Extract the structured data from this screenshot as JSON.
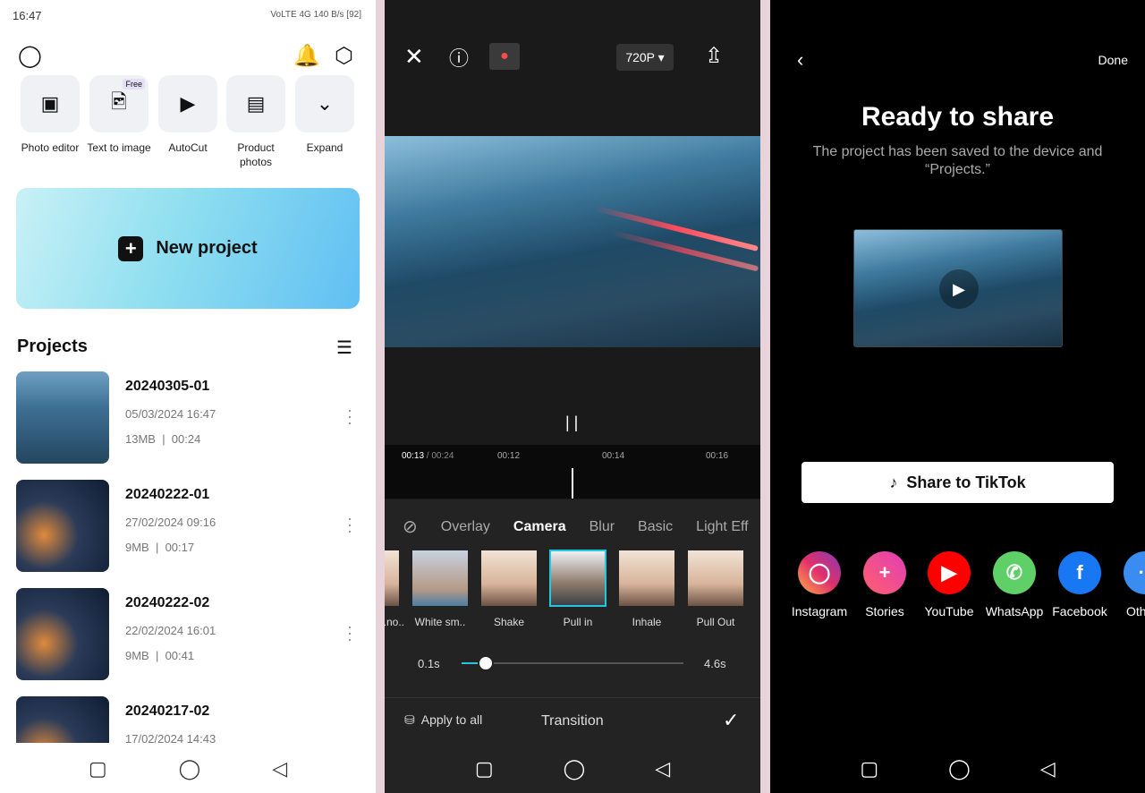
{
  "home": {
    "status": {
      "time": "16:47",
      "network": "VoLTE 4G",
      "speed": "140 B/s",
      "battery": "92"
    },
    "tools": [
      {
        "label": "Photo editor",
        "icon": "photo-editor-icon"
      },
      {
        "label": "Text to image",
        "icon": "text-to-image-icon",
        "badge": "Free"
      },
      {
        "label": "AutoCut",
        "icon": "autocut-icon"
      },
      {
        "label": "Product photos",
        "icon": "product-photos-icon"
      },
      {
        "label": "Expand",
        "icon": "chevron-down-icon"
      }
    ],
    "new_project": "New project",
    "projects_title": "Projects",
    "projects": [
      {
        "name": "20240305-01",
        "date": "05/03/2024 16:47",
        "size": "13MB",
        "duration": "00:24"
      },
      {
        "name": "20240222-01",
        "date": "27/02/2024 09:16",
        "size": "9MB",
        "duration": "00:17"
      },
      {
        "name": "20240222-02",
        "date": "22/02/2024 16:01",
        "size": "9MB",
        "duration": "00:41"
      },
      {
        "name": "20240217-02",
        "date": "17/02/2024 14:43",
        "size": "",
        "duration": ""
      }
    ]
  },
  "editor": {
    "resolution": "720P",
    "time_current": "00:13",
    "time_total": " / 00:24",
    "ticks": [
      "00:12",
      "00:14",
      "00:16"
    ],
    "tabs": [
      "Overlay",
      "Camera",
      "Blur",
      "Basic",
      "Light Eff"
    ],
    "active_tab": "Camera",
    "effects": [
      "...no..",
      "White sm..",
      "Shake",
      "Pull in",
      "Inhale",
      "Pull Out"
    ],
    "selected_effect": "Pull in",
    "duration_min": "0.1s",
    "duration_max": "4.6s",
    "duration_fraction": 0.11,
    "apply_all": "Apply to all",
    "panel_title": "Transition",
    "accent": "#22c7e0"
  },
  "share": {
    "done": "Done",
    "title": "Ready to share",
    "subtitle": "The project has been saved to the device and “Projects.”",
    "tiktok": "Share to TikTok",
    "targets": [
      {
        "label": "Instagram",
        "color": "#e1306c"
      },
      {
        "label": "Stories",
        "color": "#f0398b"
      },
      {
        "label": "YouTube",
        "color": "#ff0000"
      },
      {
        "label": "WhatsApp",
        "color": "#5fd068"
      },
      {
        "label": "Facebook",
        "color": "#1877f2"
      },
      {
        "label": "Oth",
        "color": "#3b8cf0"
      }
    ]
  }
}
